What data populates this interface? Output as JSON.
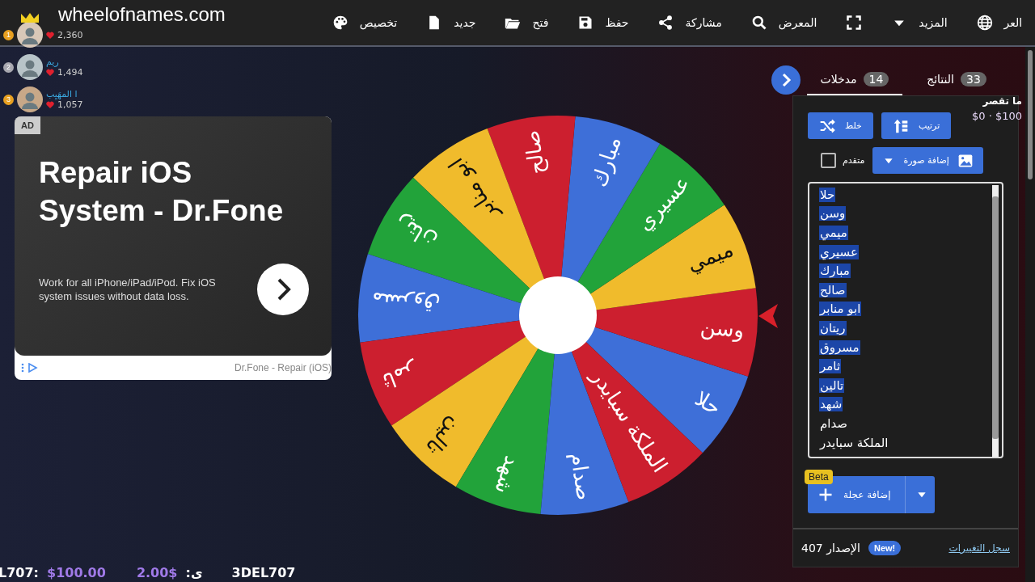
{
  "topbar": {
    "logo": "wheelofnames.com",
    "items": [
      {
        "kind": "globe",
        "label": "العر"
      },
      {
        "kind": "caret",
        "label": "المزيد"
      },
      {
        "kind": "fullscreen"
      },
      {
        "kind": "search",
        "label": "المعرض"
      },
      {
        "kind": "share",
        "label": "مشاركة"
      },
      {
        "kind": "save",
        "label": "حفظ"
      },
      {
        "kind": "folder",
        "label": "فتح"
      },
      {
        "kind": "file",
        "label": "جديد"
      },
      {
        "kind": "palette",
        "label": "تخصيص"
      }
    ]
  },
  "leaderboard": [
    {
      "rank": "1",
      "score": "2,360",
      "crown": true
    },
    {
      "rank": "2",
      "name": "ريم",
      "score": "1,494",
      "crown": false
    },
    {
      "rank": "3",
      "name": "ا المهَيِب",
      "score": "1,057",
      "crown": false
    }
  ],
  "ad": {
    "badge": "AD",
    "title": "Repair iOS System - Dr.Fone",
    "text": "Work for all iPhone/iPad/iPod. Fix iOS system issues without data loss.",
    "footer": "Dr.Fone - Repair (iOS)"
  },
  "wheel": {
    "slices": [
      {
        "label": "حلا",
        "color": "#3e6fd8"
      },
      {
        "label": "وسن",
        "color": "#cc1f2f"
      },
      {
        "label": "ميمي",
        "color": "#f0bb2c"
      },
      {
        "label": "عسيري",
        "color": "#22a33a"
      },
      {
        "label": "مبارك",
        "color": "#3e6fd8"
      },
      {
        "label": "صالح",
        "color": "#cc1f2f"
      },
      {
        "label": "ابو منابر",
        "color": "#f0bb2c"
      },
      {
        "label": "ريتان",
        "color": "#22a33a"
      },
      {
        "label": "مسروق",
        "color": "#3e6fd8"
      },
      {
        "label": "ثامر",
        "color": "#cc1f2f"
      },
      {
        "label": "تالين",
        "color": "#f0bb2c"
      },
      {
        "label": "شهد",
        "color": "#22a33a"
      },
      {
        "label": "صدام",
        "color": "#3e6fd8"
      },
      {
        "label": "الملكة سبايدر",
        "color": "#cc1f2f"
      }
    ]
  },
  "panel": {
    "tabs": [
      {
        "label": "النتائج",
        "count": "33",
        "selected": false
      },
      {
        "label": "مدخلات",
        "count": "14",
        "selected": true
      }
    ],
    "overlay": {
      "title": "ما تقصر",
      "range": "$0 · $100"
    },
    "buttons": [
      {
        "kind": "sort",
        "label": "ترتيب"
      },
      {
        "kind": "shuffle",
        "label": "خلط"
      }
    ],
    "image_button": {
      "label": "إضافة صورة"
    },
    "advanced": {
      "label": "متقدم",
      "checked": false
    },
    "entries": [
      {
        "text": "حلا",
        "selected": true
      },
      {
        "text": "وسن",
        "selected": true
      },
      {
        "text": "ميمي",
        "selected": true
      },
      {
        "text": "عسيري",
        "selected": true
      },
      {
        "text": "مبارك",
        "selected": true
      },
      {
        "text": "صالح",
        "selected": true
      },
      {
        "text": "ابو منابر",
        "selected": true
      },
      {
        "text": "ريتان",
        "selected": true
      },
      {
        "text": "مسروق",
        "selected": true
      },
      {
        "text": "ثامر",
        "selected": true
      },
      {
        "text": "تالين",
        "selected": true
      },
      {
        "text": "شهد",
        "selected": true
      },
      {
        "text": "صدام",
        "selected": false
      },
      {
        "text": "الملكة سبايدر",
        "selected": false
      }
    ],
    "add_wheel": {
      "label": "إضافة عجلة",
      "badge": "Beta"
    },
    "footer": {
      "version": "الإصدار 407",
      "badge": "New!",
      "link": "سجل التغييرات"
    }
  },
  "ticker": [
    {
      "kind": "text",
      "text": "3DEL707"
    },
    {
      "kind": "text",
      "text": "ى:"
    },
    {
      "kind": "amount",
      "text": "2.00$"
    },
    {
      "kind": "amount",
      "text": "$100.00"
    },
    {
      "kind": "text",
      "text": "L707:"
    }
  ]
}
